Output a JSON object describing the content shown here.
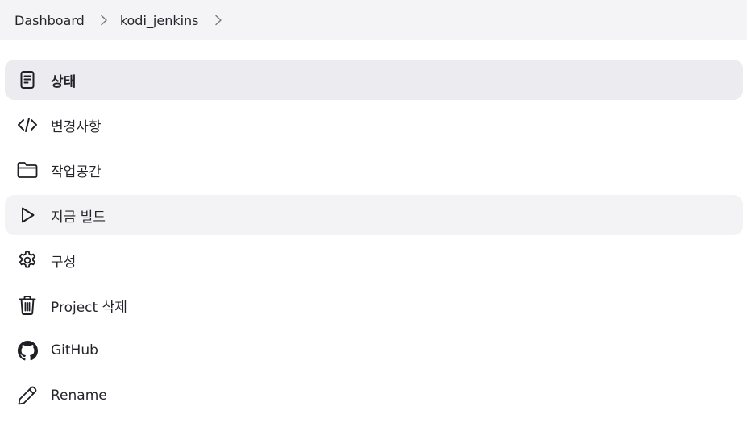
{
  "breadcrumb": {
    "items": [
      {
        "label": "Dashboard"
      },
      {
        "label": "kodi_jenkins"
      }
    ]
  },
  "sidebar": {
    "items": [
      {
        "label": "상태",
        "icon": "document-icon",
        "state": "active"
      },
      {
        "label": "변경사항",
        "icon": "code-icon"
      },
      {
        "label": "작업공간",
        "icon": "folder-icon"
      },
      {
        "label": "지금 빌드",
        "icon": "play-icon",
        "state": "hover"
      },
      {
        "label": "구성",
        "icon": "gear-icon"
      },
      {
        "label": "Project 삭제",
        "icon": "trash-icon"
      },
      {
        "label": "GitHub",
        "icon": "github-icon"
      },
      {
        "label": "Rename",
        "icon": "pencil-icon"
      }
    ]
  },
  "colors": {
    "breadcrumb_bg": "#f4f4f7",
    "active_bg": "#ebebf0",
    "hover_bg": "#f3f3f6",
    "text": "#24242b"
  }
}
